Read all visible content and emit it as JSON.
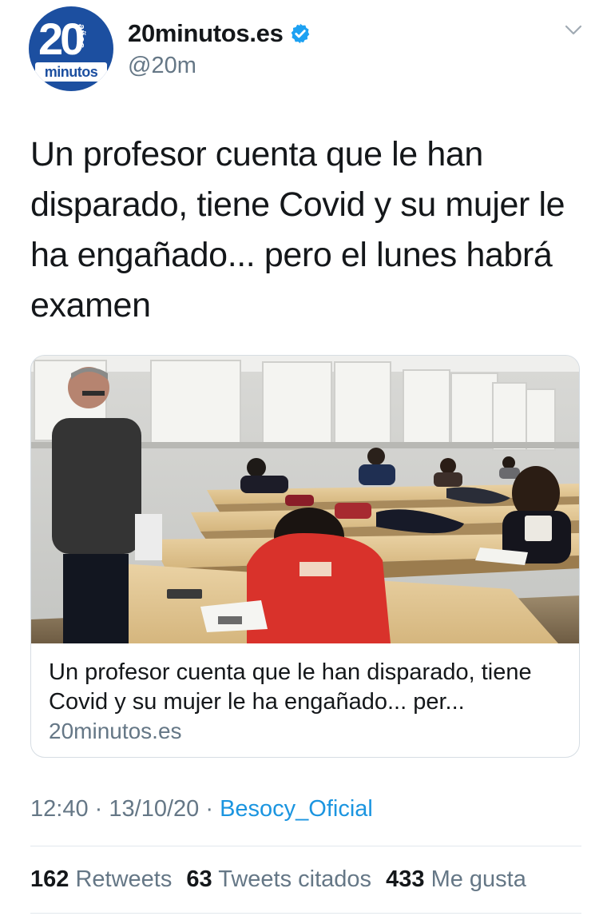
{
  "account": {
    "display_name": "20minutos.es",
    "handle": "@20m",
    "avatar": {
      "number": "20",
      "years": "años",
      "brand": "minutos"
    }
  },
  "tweet": {
    "text": "Un profesor cuenta que le han disparado, tiene Covid y su mujer le ha engañado... pero el lunes habrá examen"
  },
  "card": {
    "title": "Un profesor cuenta que le han disparado, tiene Covid y su mujer le ha engañado... per...",
    "domain": "20minutos.es"
  },
  "meta": {
    "time": "12:40",
    "date": "13/10/20",
    "separator": "·",
    "source": "Besocy_Oficial"
  },
  "stats": {
    "retweets_count": "162",
    "retweets_label": "Retweets",
    "quotes_count": "63",
    "quotes_label": "Tweets citados",
    "likes_count": "433",
    "likes_label": "Me gusta"
  },
  "colors": {
    "brand_blue": "#1c4fa0",
    "verified": "#1da1f2",
    "link": "#1b95e0",
    "secondary_text": "#657786"
  },
  "icons": [
    "verified-icon",
    "chevron-down-icon"
  ]
}
